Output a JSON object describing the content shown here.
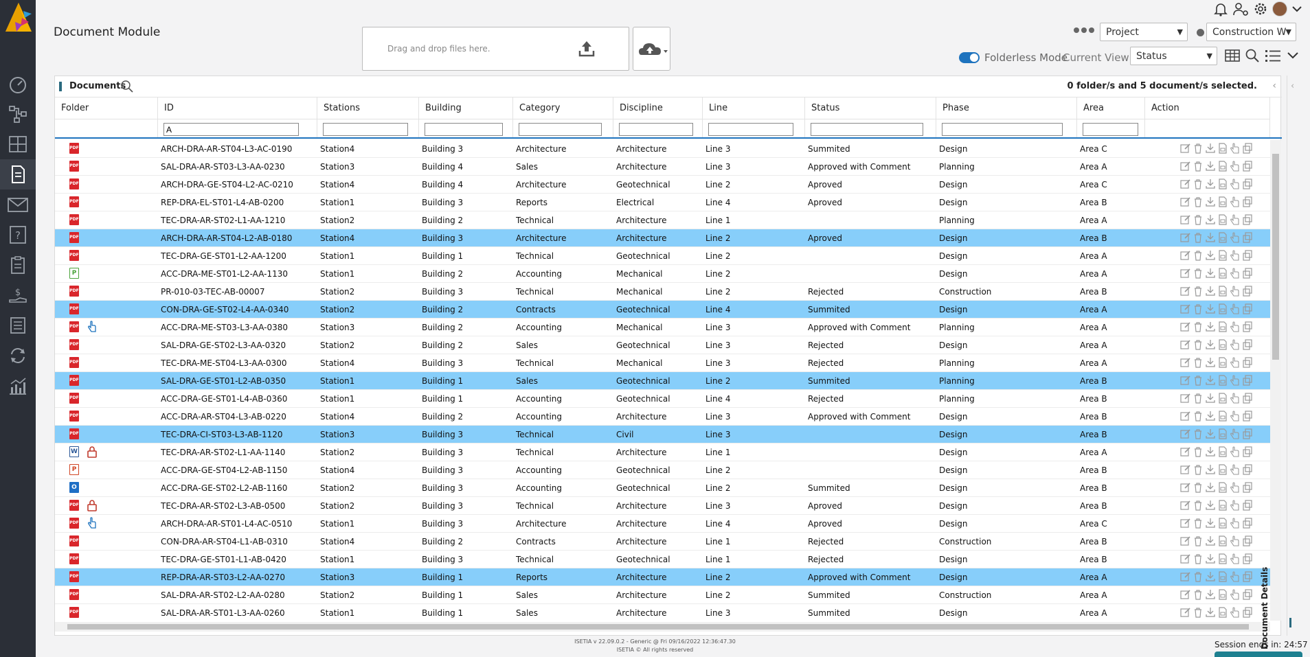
{
  "header": {
    "title": "Document Module",
    "dropzone_text": "Drag and drop files here.",
    "project_select": "Project",
    "workspace_select": "Construction W",
    "folderless_label": "Folderless Mode",
    "current_view_label": "Current View",
    "view_select": "Status"
  },
  "panel": {
    "title": "Documents",
    "selection_info": "0 folder/s and 5 document/s selected."
  },
  "columns": [
    {
      "label": "Folder",
      "filter": null
    },
    {
      "label": "ID",
      "filter": "A"
    },
    {
      "label": "Stations",
      "filter": ""
    },
    {
      "label": "Building",
      "filter": ""
    },
    {
      "label": "Category",
      "filter": ""
    },
    {
      "label": "Discipline",
      "filter": ""
    },
    {
      "label": "Line",
      "filter": ""
    },
    {
      "label": "Status",
      "filter": ""
    },
    {
      "label": "Phase",
      "filter": ""
    },
    {
      "label": "Area",
      "filter": ""
    },
    {
      "label": "Action",
      "filter": null
    }
  ],
  "rows": [
    {
      "icon": "pdf",
      "badge": "",
      "selected": false,
      "id": "ARCH-DRA-AR-ST04-L3-AC-0190",
      "station": "Station4",
      "building": "Building 3",
      "category": "Architecture",
      "discipline": "Architecture",
      "line": "Line 3",
      "status": "Summited",
      "phase": "Design",
      "area": "Area C"
    },
    {
      "icon": "pdf",
      "badge": "",
      "selected": false,
      "id": "SAL-DRA-AR-ST03-L3-AA-0230",
      "station": "Station3",
      "building": "Building 4",
      "category": "Sales",
      "discipline": "Architecture",
      "line": "Line 3",
      "status": "Approved with Comment",
      "phase": "Planning",
      "area": "Area A"
    },
    {
      "icon": "pdf",
      "badge": "",
      "selected": false,
      "id": "ARCH-DRA-GE-ST04-L2-AC-0210",
      "station": "Station4",
      "building": "Building 4",
      "category": "Architecture",
      "discipline": "Geotechnical",
      "line": "Line 2",
      "status": "Aproved",
      "phase": "Design",
      "area": "Area C"
    },
    {
      "icon": "pdf",
      "badge": "",
      "selected": false,
      "id": "REP-DRA-EL-ST01-L4-AB-0200",
      "station": "Station1",
      "building": "Building 3",
      "category": "Reports",
      "discipline": "Electrical",
      "line": "Line 4",
      "status": "Aproved",
      "phase": "Design",
      "area": "Area B"
    },
    {
      "icon": "pdf",
      "badge": "",
      "selected": false,
      "id": "TEC-DRA-AR-ST02-L1-AA-1210",
      "station": "Station2",
      "building": "Building 2",
      "category": "Technical",
      "discipline": "Architecture",
      "line": "Line 1",
      "status": "",
      "phase": "Planning",
      "area": "Area A"
    },
    {
      "icon": "pdf",
      "badge": "",
      "selected": true,
      "id": "ARCH-DRA-AR-ST04-L2-AB-0180",
      "station": "Station4",
      "building": "Building 3",
      "category": "Architecture",
      "discipline": "Architecture",
      "line": "Line 2",
      "status": "Aproved",
      "phase": "Design",
      "area": "Area B"
    },
    {
      "icon": "pdf",
      "badge": "",
      "selected": false,
      "id": "TEC-DRA-GE-ST01-L2-AA-1200",
      "station": "Station1",
      "building": "Building 1",
      "category": "Technical",
      "discipline": "Geotechnical",
      "line": "Line 2",
      "status": "",
      "phase": "Design",
      "area": "Area A"
    },
    {
      "icon": "proj",
      "badge": "",
      "selected": false,
      "id": "ACC-DRA-ME-ST01-L2-AA-1130",
      "station": "Station1",
      "building": "Building 2",
      "category": "Accounting",
      "discipline": "Mechanical",
      "line": "Line 2",
      "status": "",
      "phase": "Design",
      "area": "Area A"
    },
    {
      "icon": "pdf",
      "badge": "",
      "selected": false,
      "id": "PR-010-03-TEC-AB-00007",
      "station": "Station2",
      "building": "Building 3",
      "category": "Technical",
      "discipline": "Mechanical",
      "line": "Line 2",
      "status": "Rejected",
      "phase": "Construction",
      "area": "Area B"
    },
    {
      "icon": "pdf",
      "badge": "",
      "selected": true,
      "id": "CON-DRA-GE-ST02-L4-AA-0340",
      "station": "Station2",
      "building": "Building 2",
      "category": "Contracts",
      "discipline": "Geotechnical",
      "line": "Line 4",
      "status": "Summited",
      "phase": "Design",
      "area": "Area A"
    },
    {
      "icon": "pdf",
      "badge": "hand",
      "selected": false,
      "id": "ACC-DRA-ME-ST03-L3-AA-0380",
      "station": "Station3",
      "building": "Building 2",
      "category": "Accounting",
      "discipline": "Mechanical",
      "line": "Line 3",
      "status": "Approved with Comment",
      "phase": "Planning",
      "area": "Area A"
    },
    {
      "icon": "pdf",
      "badge": "",
      "selected": false,
      "id": "SAL-DRA-GE-ST02-L3-AA-0320",
      "station": "Station2",
      "building": "Building 2",
      "category": "Sales",
      "discipline": "Geotechnical",
      "line": "Line 3",
      "status": "Rejected",
      "phase": "Design",
      "area": "Area A"
    },
    {
      "icon": "pdf",
      "badge": "",
      "selected": false,
      "id": "TEC-DRA-ME-ST04-L3-AA-0300",
      "station": "Station4",
      "building": "Building 3",
      "category": "Technical",
      "discipline": "Mechanical",
      "line": "Line 3",
      "status": "Rejected",
      "phase": "Planning",
      "area": "Area A"
    },
    {
      "icon": "pdf",
      "badge": "",
      "selected": true,
      "id": "SAL-DRA-GE-ST01-L2-AB-0350",
      "station": "Station1",
      "building": "Building 1",
      "category": "Sales",
      "discipline": "Geotechnical",
      "line": "Line 2",
      "status": "Summited",
      "phase": "Planning",
      "area": "Area B"
    },
    {
      "icon": "pdf",
      "badge": "",
      "selected": false,
      "id": "ACC-DRA-GE-ST01-L4-AB-0360",
      "station": "Station1",
      "building": "Building 1",
      "category": "Accounting",
      "discipline": "Geotechnical",
      "line": "Line 4",
      "status": "Rejected",
      "phase": "Planning",
      "area": "Area B"
    },
    {
      "icon": "pdf",
      "badge": "",
      "selected": false,
      "id": "ACC-DRA-AR-ST04-L3-AB-0220",
      "station": "Station4",
      "building": "Building 2",
      "category": "Accounting",
      "discipline": "Architecture",
      "line": "Line 3",
      "status": "Approved with Comment",
      "phase": "Design",
      "area": "Area B"
    },
    {
      "icon": "pdf",
      "badge": "",
      "selected": true,
      "id": "TEC-DRA-CI-ST03-L3-AB-1120",
      "station": "Station3",
      "building": "Building 3",
      "category": "Technical",
      "discipline": "Civil",
      "line": "Line 3",
      "status": "",
      "phase": "Design",
      "area": "Area B"
    },
    {
      "icon": "word",
      "badge": "lock",
      "selected": false,
      "id": "TEC-DRA-AR-ST02-L1-AA-1140",
      "station": "Station2",
      "building": "Building 3",
      "category": "Technical",
      "discipline": "Architecture",
      "line": "Line 1",
      "status": "",
      "phase": "Design",
      "area": "Area A"
    },
    {
      "icon": "ppt",
      "badge": "",
      "selected": false,
      "id": "ACC-DRA-GE-ST04-L2-AB-1150",
      "station": "Station4",
      "building": "Building 3",
      "category": "Accounting",
      "discipline": "Geotechnical",
      "line": "Line 2",
      "status": "",
      "phase": "Design",
      "area": "Area B"
    },
    {
      "icon": "outlook",
      "badge": "",
      "selected": false,
      "id": "ACC-DRA-GE-ST02-L2-AB-1160",
      "station": "Station2",
      "building": "Building 3",
      "category": "Accounting",
      "discipline": "Geotechnical",
      "line": "Line 2",
      "status": "Summited",
      "phase": "Design",
      "area": "Area B"
    },
    {
      "icon": "pdf",
      "badge": "lock",
      "selected": false,
      "id": "TEC-DRA-AR-ST02-L3-AB-0500",
      "station": "Station2",
      "building": "Building 3",
      "category": "Technical",
      "discipline": "Architecture",
      "line": "Line 3",
      "status": "Aproved",
      "phase": "Design",
      "area": "Area B"
    },
    {
      "icon": "pdf",
      "badge": "hand",
      "selected": false,
      "id": "ARCH-DRA-AR-ST01-L4-AC-0510",
      "station": "Station1",
      "building": "Building 3",
      "category": "Architecture",
      "discipline": "Architecture",
      "line": "Line 4",
      "status": "Aproved",
      "phase": "Design",
      "area": "Area C"
    },
    {
      "icon": "pdf",
      "badge": "",
      "selected": false,
      "id": "CON-DRA-AR-ST04-L1-AB-0310",
      "station": "Station4",
      "building": "Building 2",
      "category": "Contracts",
      "discipline": "Architecture",
      "line": "Line 1",
      "status": "Rejected",
      "phase": "Construction",
      "area": "Area B"
    },
    {
      "icon": "pdf",
      "badge": "",
      "selected": false,
      "id": "TEC-DRA-GE-ST01-L1-AB-0420",
      "station": "Station1",
      "building": "Building 3",
      "category": "Technical",
      "discipline": "Geotechnical",
      "line": "Line 1",
      "status": "Rejected",
      "phase": "Design",
      "area": "Area B"
    },
    {
      "icon": "pdf",
      "badge": "",
      "selected": true,
      "id": "REP-DRA-AR-ST03-L2-AA-0270",
      "station": "Station3",
      "building": "Building 1",
      "category": "Reports",
      "discipline": "Architecture",
      "line": "Line 2",
      "status": "Approved with Comment",
      "phase": "Design",
      "area": "Area A"
    },
    {
      "icon": "pdf",
      "badge": "",
      "selected": false,
      "id": "SAL-DRA-AR-ST02-L2-AA-0280",
      "station": "Station2",
      "building": "Building 1",
      "category": "Sales",
      "discipline": "Architecture",
      "line": "Line 2",
      "status": "Summited",
      "phase": "Construction",
      "area": "Area A"
    },
    {
      "icon": "pdf",
      "badge": "",
      "selected": false,
      "id": "SAL-DRA-AR-ST01-L3-AA-0260",
      "station": "Station1",
      "building": "Building 1",
      "category": "Sales",
      "discipline": "Architecture",
      "line": "Line 3",
      "status": "Summited",
      "phase": "Design",
      "area": "Area A"
    }
  ],
  "right_panel": {
    "label": "Document Details"
  },
  "footer": {
    "version": "ISETIA v 22.09.0.2 - Generic @ Fri 09/16/2022 12:36:47.30",
    "copyright": "ISETIA © All rights reserved",
    "session": "Session ends in: 24:57"
  },
  "icons": {
    "sidebar": [
      "dashboard-icon",
      "workflow-icon",
      "grid-icon",
      "document-icon",
      "mail-icon",
      "help-icon",
      "clipboard-icon",
      "payment-icon",
      "book-icon",
      "sync-icon",
      "analytics-icon"
    ],
    "file_types": {
      "pdf": "PDF",
      "word": "W",
      "ppt": "P",
      "proj": "P",
      "outlook": "O"
    }
  },
  "colors": {
    "selected_row": "#87cefa",
    "accent": "#1e73be",
    "sidebar": "#2b2f37"
  }
}
